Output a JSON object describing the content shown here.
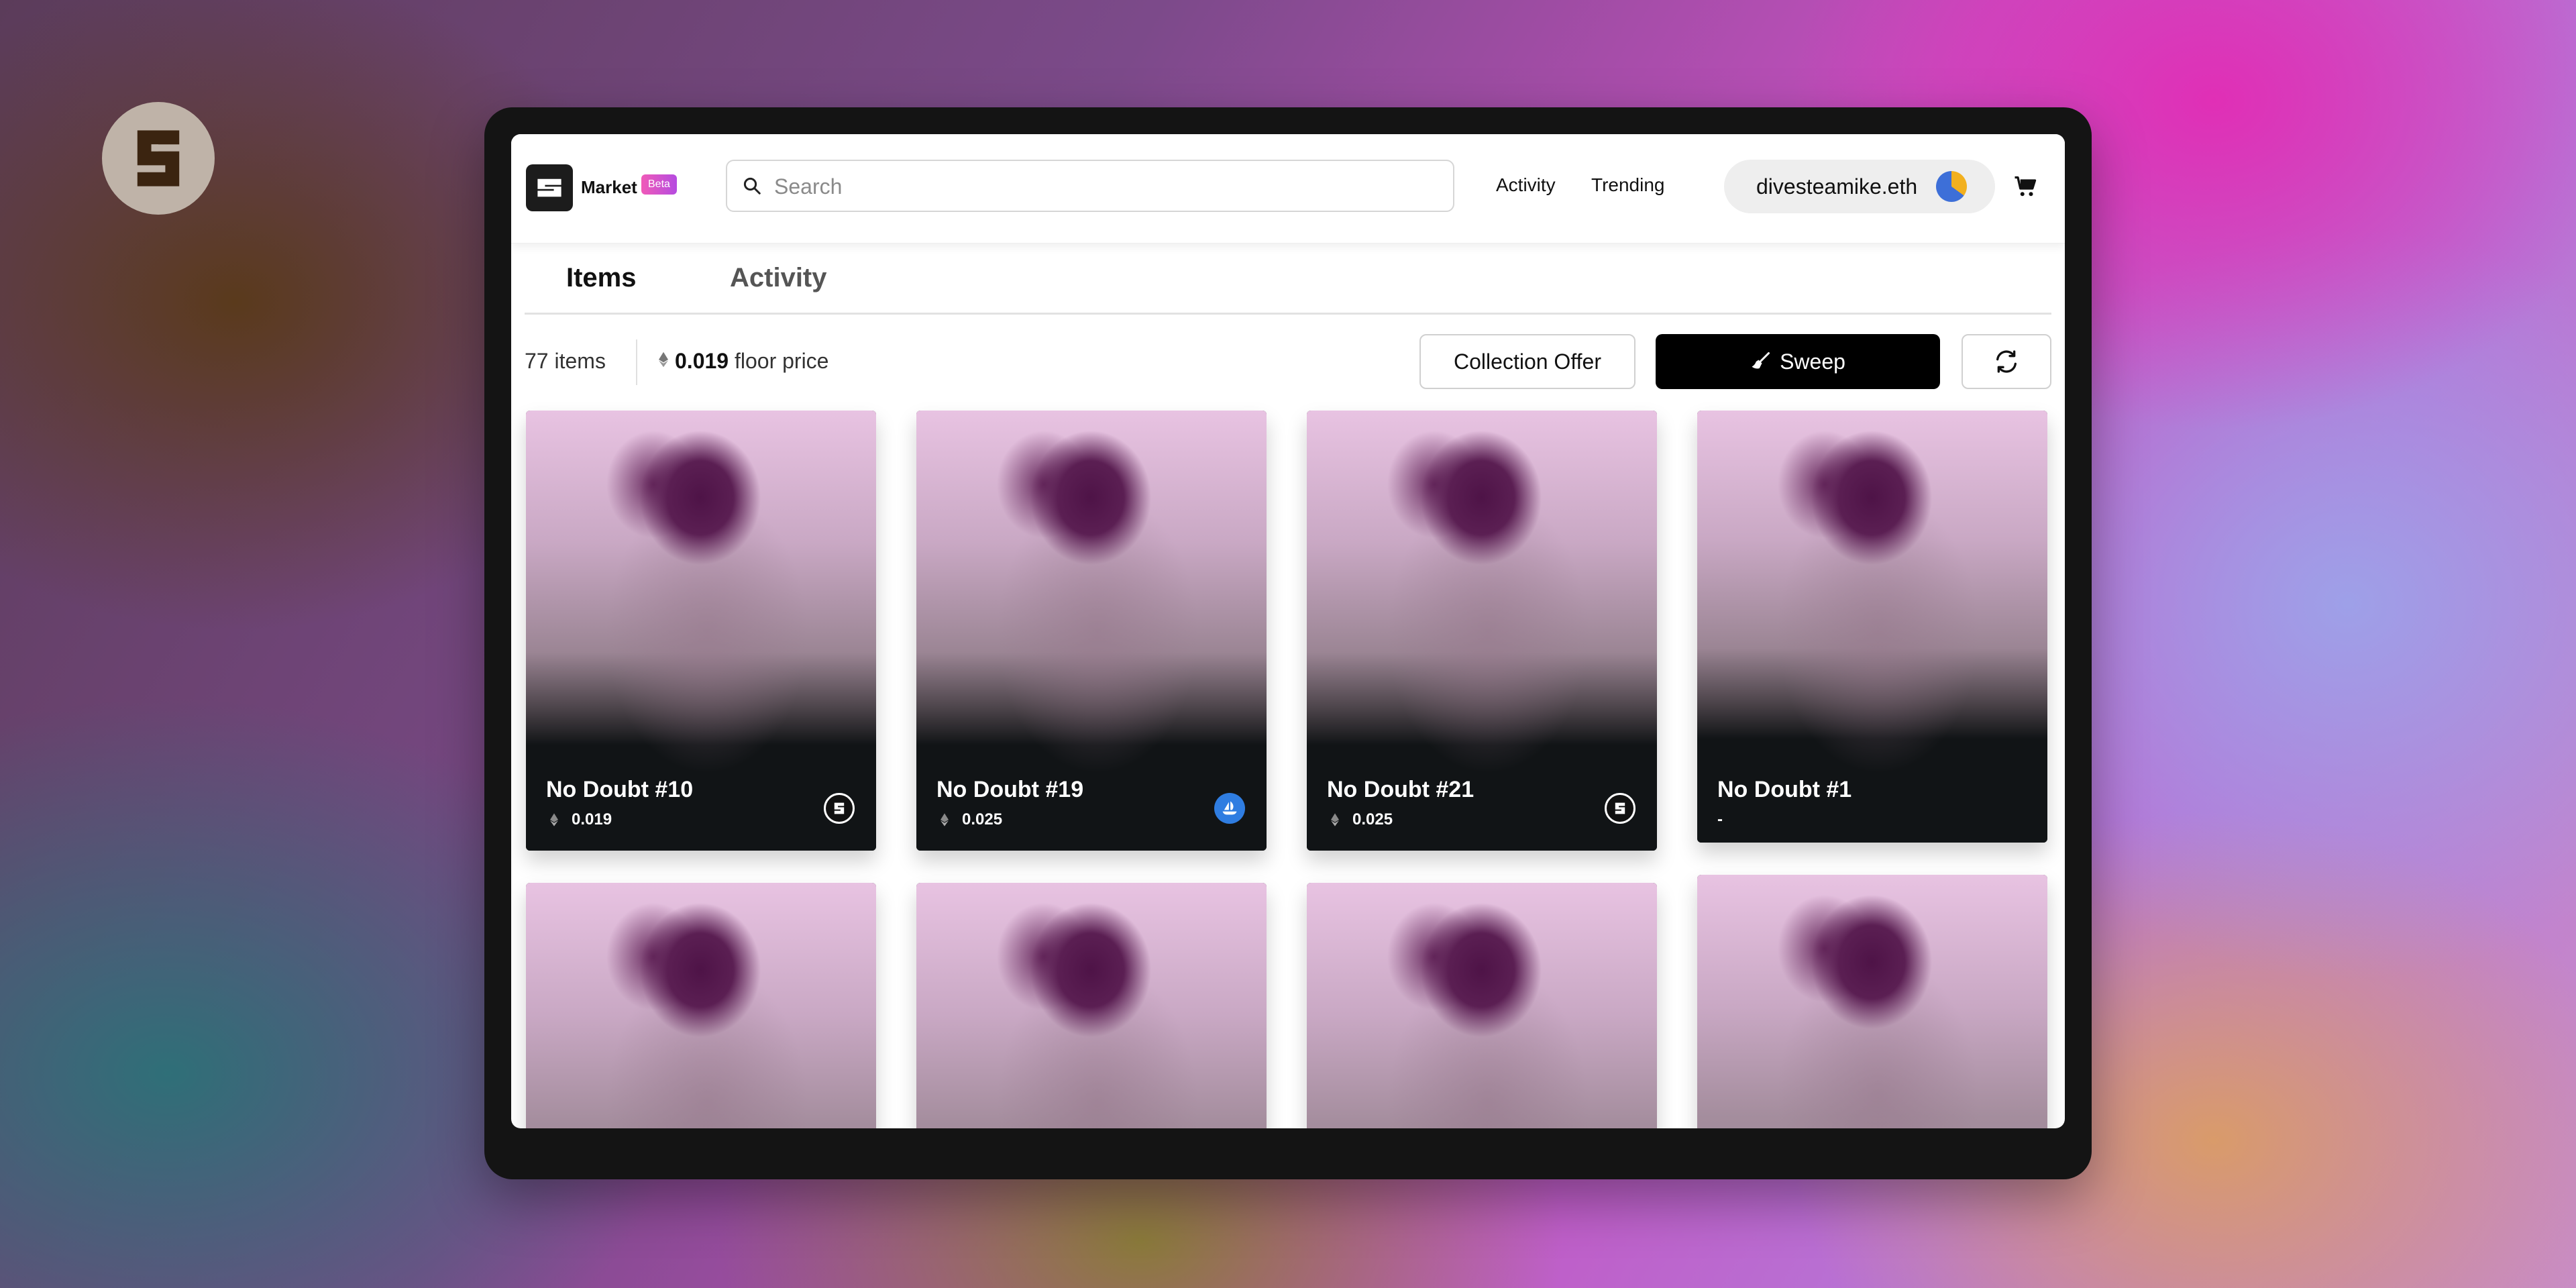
{
  "app": {
    "title": "Market",
    "badge": "Beta",
    "brand_icon": "sudoswap-s-icon"
  },
  "search": {
    "placeholder": "Search",
    "value": ""
  },
  "nav": {
    "activity": "Activity",
    "trending": "Trending"
  },
  "wallet": {
    "name": "divesteamike.eth",
    "avatar_colors": [
      "#f2b01f",
      "#3d6fd8"
    ]
  },
  "tabs": {
    "items": "Items",
    "activity": "Activity",
    "selected": "Items"
  },
  "toolbar": {
    "items_count": "77 items",
    "floor_value": "0.019",
    "floor_label": "floor price",
    "collection_offer": "Collection Offer",
    "sweep": "Sweep",
    "refresh_icon": "refresh-icon"
  },
  "cards": [
    {
      "title": "No Doubt #10",
      "price": "0.019",
      "marketplace": "sudoswap"
    },
    {
      "title": "No Doubt #19",
      "price": "0.025",
      "marketplace": "opensea"
    },
    {
      "title": "No Doubt #21",
      "price": "0.025",
      "marketplace": "sudoswap"
    },
    {
      "title": "No Doubt #1",
      "price": "-",
      "marketplace": ""
    }
  ],
  "colors": {
    "accent_gradient": [
      "#f05ab8",
      "#b54be0"
    ],
    "opensea_blue": "#2f7de1",
    "sweep_button": "#000000"
  }
}
